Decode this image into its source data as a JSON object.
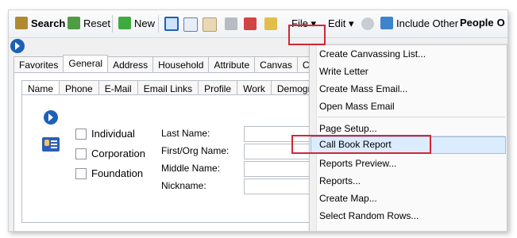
{
  "toolbar": {
    "search": "Search",
    "reset": "Reset",
    "new": "New",
    "file": "File ▾",
    "edit": "Edit ▾",
    "include_other": "Include Other",
    "people": "People",
    "trailing": "O"
  },
  "tabs1": [
    "Favorites",
    "General",
    "Address",
    "Household",
    "Attribute",
    "Canvas",
    "Co"
  ],
  "tabs2": [
    "Name",
    "Phone",
    "E-Mail",
    "Email Links",
    "Profile",
    "Work",
    "Demogra"
  ],
  "checkboxes": [
    "Individual",
    "Corporation",
    "Foundation"
  ],
  "form_labels": [
    "Last Name:",
    "First/Org Name:",
    "Middle Name:",
    "Nickname:"
  ],
  "menu": {
    "items": [
      "Create Canvassing List...",
      "Write Letter",
      "Create Mass Email...",
      "Open Mass Email",
      "Page Setup...",
      "Call Book Report",
      "Reports Preview...",
      "Reports...",
      "Create Map...",
      "Select Random Rows..."
    ]
  },
  "colors": {
    "highlight": "#d32635",
    "accent": "#1c61b5"
  }
}
